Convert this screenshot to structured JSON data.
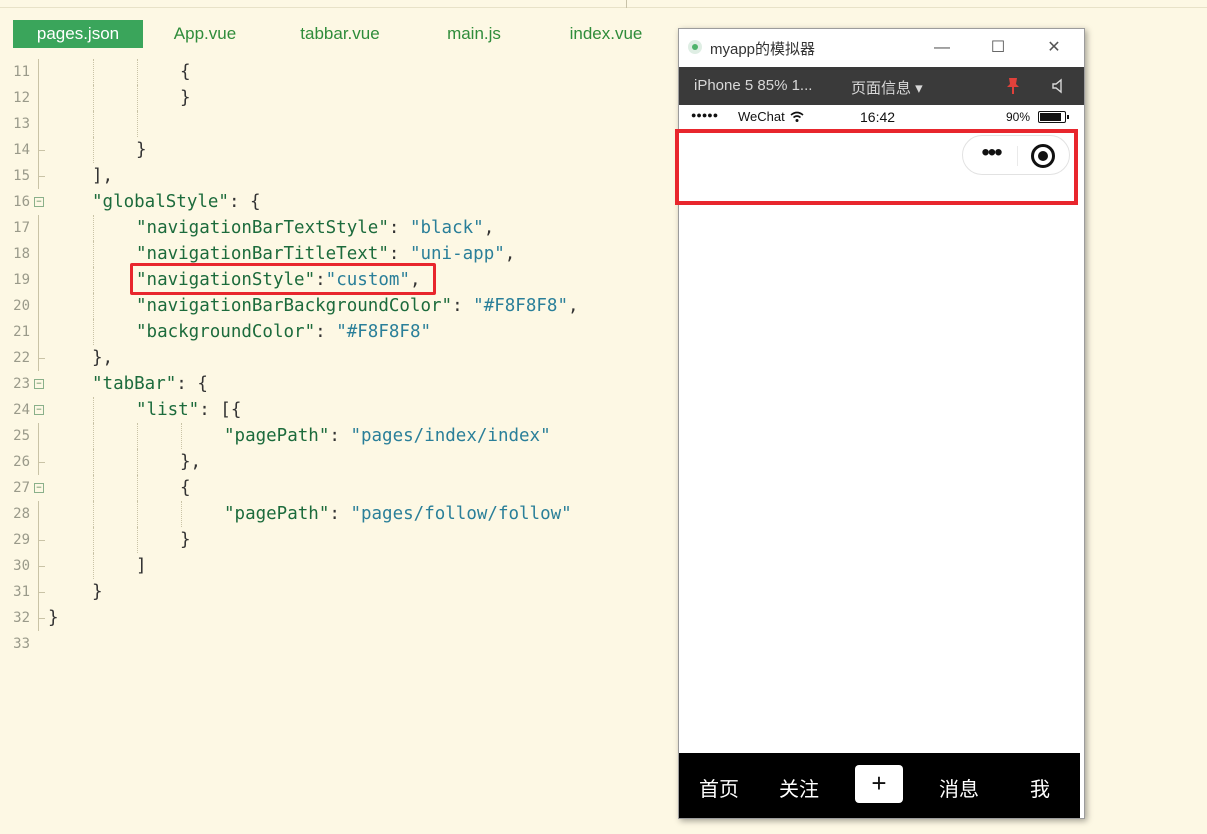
{
  "tabs": [
    {
      "label": "pages.json",
      "active": true
    },
    {
      "label": "App.vue"
    },
    {
      "label": "tabbar.vue"
    },
    {
      "label": "main.js"
    },
    {
      "label": "index.vue"
    }
  ],
  "code": [
    {
      "n": "11",
      "t": "{"
    },
    {
      "n": "12",
      "t": "}"
    },
    {
      "n": "13",
      "t": ""
    },
    {
      "n": "14",
      "t": "}"
    },
    {
      "n": "15",
      "t": "],"
    },
    {
      "n": "16",
      "key": "\"globalStyle\"",
      "rest": ": {"
    },
    {
      "n": "17",
      "key": "\"navigationBarTextStyle\"",
      "mid": ": ",
      "val": "\"black\"",
      "end": ","
    },
    {
      "n": "18",
      "key": "\"navigationBarTitleText\"",
      "mid": ": ",
      "val": "\"uni-app\"",
      "end": ","
    },
    {
      "n": "19",
      "key": "\"navigationStyle\"",
      "mid": ":",
      "val": "\"custom\"",
      "end": ","
    },
    {
      "n": "20",
      "key": "\"navigationBarBackgroundColor\"",
      "mid": ": ",
      "val": "\"#F8F8F8\"",
      "end": ","
    },
    {
      "n": "21",
      "key": "\"backgroundColor\"",
      "mid": ": ",
      "val": "\"#F8F8F8\"",
      "end": ""
    },
    {
      "n": "22",
      "t": "},"
    },
    {
      "n": "23",
      "key": "\"tabBar\"",
      "rest": ": {"
    },
    {
      "n": "24",
      "key": "\"list\"",
      "rest": ": [{"
    },
    {
      "n": "25",
      "key": "\"pagePath\"",
      "mid": ": ",
      "val": "\"pages/index/index\"",
      "end": ""
    },
    {
      "n": "26",
      "t": "},"
    },
    {
      "n": "27",
      "t": "{"
    },
    {
      "n": "28",
      "key": "\"pagePath\"",
      "mid": ": ",
      "val": "\"pages/follow/follow\"",
      "end": ""
    },
    {
      "n": "29",
      "t": "}"
    },
    {
      "n": "30",
      "t": "]"
    },
    {
      "n": "31",
      "t": "}"
    },
    {
      "n": "32",
      "t": "}"
    },
    {
      "n": "33",
      "t": ""
    }
  ],
  "simulator": {
    "title": "myapp的模拟器",
    "device": "iPhone 5 85% 1...",
    "page_info": "页面信息 ▾",
    "status": {
      "signal": "●●●●●",
      "carrier": "WeChat",
      "time": "16:42",
      "battery": "90%"
    },
    "tabbar": {
      "home": "首页",
      "follow": "关注",
      "plus": "+",
      "messages": "消息",
      "me": "我"
    }
  },
  "colors": {
    "highlight": "#e8262d",
    "tab_active": "#3aa55b",
    "editor_bg": "#fdf8e4"
  }
}
